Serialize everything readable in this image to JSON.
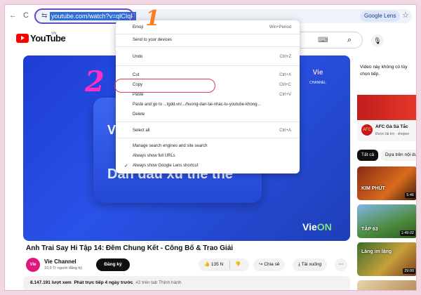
{
  "browser": {
    "back_icon": "←",
    "forward_icon": "→",
    "reload_icon": "C",
    "site_info_icon": "⇆",
    "url": "youtube.com/watch?v=qlCIqF",
    "lens_label": "Google Lens",
    "star_icon": "☆"
  },
  "annotations": {
    "step1": "1",
    "step2": "2"
  },
  "youtube": {
    "logo_text": "YouTube",
    "country_code": "VN",
    "keyboard_icon": "⌨",
    "search_icon": "⌕",
    "mic_icon": "🎙"
  },
  "context_menu": {
    "items": [
      {
        "label": "Emoji",
        "shortcut": "Win+Period",
        "check": ""
      },
      {
        "label": "Send to your devices",
        "shortcut": "",
        "check": ""
      },
      {
        "label": "Undo",
        "shortcut": "Ctrl+Z",
        "check": ""
      },
      {
        "label": "Cut",
        "shortcut": "Ctrl+X",
        "check": ""
      },
      {
        "label": "Copy",
        "shortcut": "Ctrl+C",
        "check": ""
      },
      {
        "label": "Paste",
        "shortcut": "Ctrl+V",
        "check": ""
      },
      {
        "label": "Paste and go to ...tgdd.vn/.../huong-dan-tai-nhac-tu-youtube-khong...",
        "shortcut": "",
        "check": ""
      },
      {
        "label": "Delete",
        "shortcut": "",
        "check": ""
      },
      {
        "label": "Select all",
        "shortcut": "Ctrl+A",
        "check": ""
      },
      {
        "label": "Manage search engines and site search",
        "shortcut": "",
        "check": ""
      },
      {
        "label": "Always show full URLs",
        "shortcut": "",
        "check": ""
      },
      {
        "label": "Always show Google Lens shortcut",
        "shortcut": "",
        "check": "✓"
      }
    ]
  },
  "player": {
    "line1": "Vi",
    "line2": "Dan đau xu the the",
    "badge": "Vie",
    "badge_sub": "CHANNEL",
    "logo_main": "Vie",
    "logo_accent": "ON"
  },
  "video": {
    "title": "Anh Trai Say Hi Tập 14: Đêm Chung Kết - Công Bố & Trao Giải",
    "channel_avatar": "Vie",
    "channel_name": "Vie Channel",
    "subscribers": "10,9 Tr người đăng ký",
    "subscribe_label": "Đăng ký",
    "like_icon": "👍",
    "like_count": "135 N",
    "dislike_icon": "👎",
    "share_label": "Chia sẻ",
    "share_icon": "↪",
    "download_label": "Tải xuống",
    "download_icon": "⤓",
    "more_icon": "⋯",
    "views": "8.147.191 lượt xem",
    "published": "Phát trực tiếp 4 ngày trước",
    "trending": "#2 trên tab Thịnh hành"
  },
  "sidebar": {
    "note": "Video này không có tùy chọn tiếp.",
    "ad_logo": "AFC",
    "ad_title": "AFC Gà Sả Tắc",
    "ad_sub": "Được tài trợ · shopee",
    "chip_all": "Tất cả",
    "chip_related": "Dựa trên nội dung",
    "thumbs": [
      {
        "text": "KIM PHÚT",
        "duration": "5:46"
      },
      {
        "text": "TẬP 63",
        "duration": "1:49:02"
      },
      {
        "text": "Làng im lặng",
        "duration": "29:00"
      },
      {
        "text": "",
        "duration": ""
      }
    ]
  }
}
